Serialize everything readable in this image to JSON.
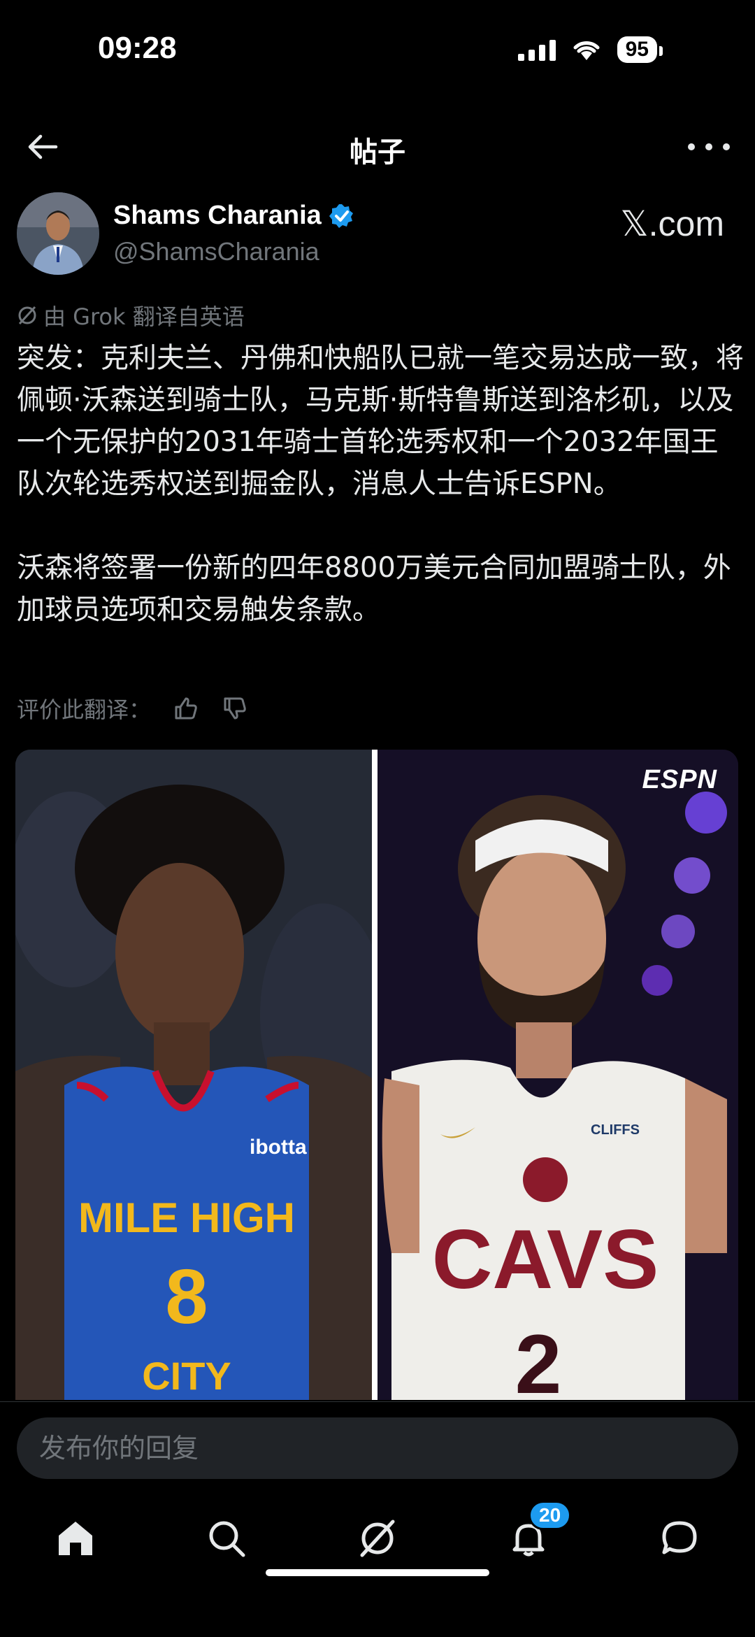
{
  "status_bar": {
    "time": "09:28",
    "battery": "95"
  },
  "header": {
    "title": "帖子"
  },
  "author": {
    "name": "Shams Charania",
    "handle": "@ShamsCharania",
    "source_logo": "𝕏.com"
  },
  "post": {
    "translation_note": "由 Grok 翻译自英语",
    "text": "突发：克利夫兰、丹佛和快船队已就一笔交易达成一致，将佩顿·沃森送到骑士队，马克斯·斯特鲁斯送到洛杉矶，以及一个无保护的2031年骑士首轮选秀权和一个2032年国王队次轮选秀权送到掘金队，消息人士告诉ESPN。\n\n沃森将签署一份新的四年8800万美元合同加盟骑士队，外加球员选项和交易触发条款。",
    "rate_label": "评价此翻译："
  },
  "media": {
    "watermark": "ESPN",
    "left_jersey": {
      "sponsor": "ibotta",
      "text_top": "MILE HIGH",
      "number": "8",
      "text_bottom": "CITY"
    },
    "right_jersey": {
      "sponsor": "CLIFFS",
      "text": "CAVS",
      "number": "2"
    }
  },
  "reply": {
    "placeholder": "发布你的回复"
  },
  "bottom_nav": {
    "notifications_badge": "20"
  },
  "colors": {
    "accent": "#1d9bf0",
    "background": "#000000",
    "muted": "#71767b"
  }
}
